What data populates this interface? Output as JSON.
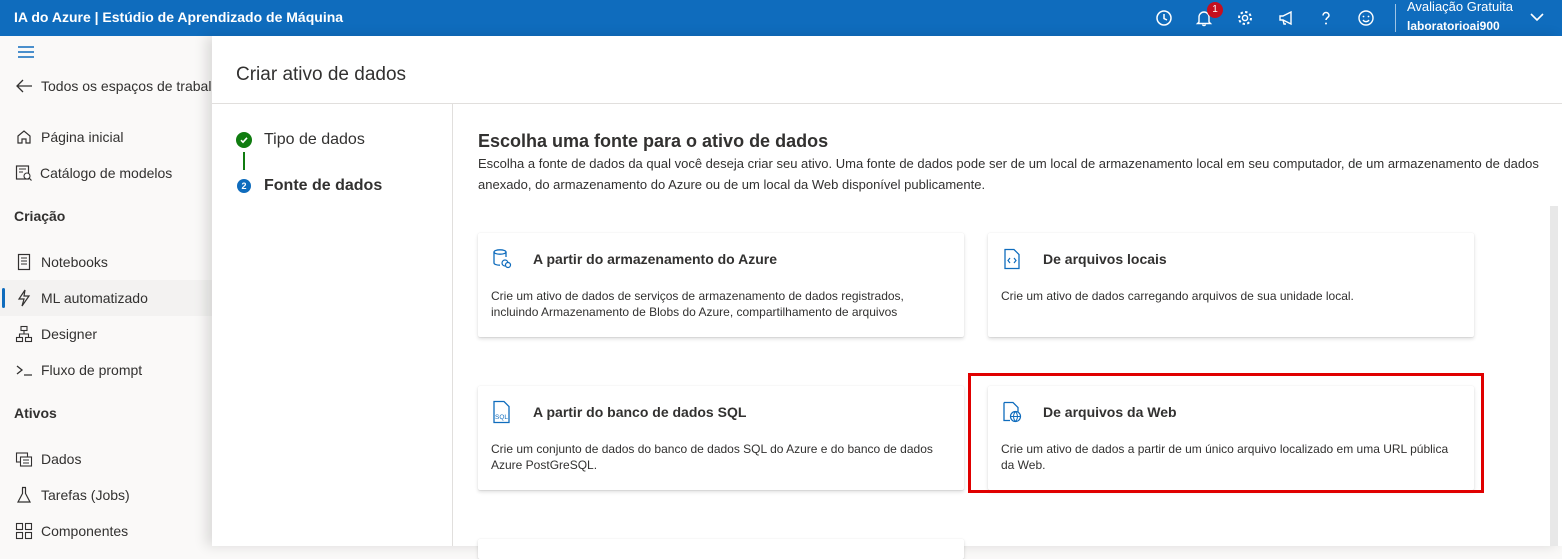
{
  "app": {
    "title": "IA do Azure | Estúdio de Aprendizado de Máquina",
    "notification_count": "1",
    "account_plan": "Avaliação Gratuita",
    "account_name": "laboratorioai900"
  },
  "topbar_icons": [
    "clock-icon",
    "bell-icon",
    "gear-icon",
    "megaphone-icon",
    "help-icon",
    "smiley-icon",
    "chevron-down-icon"
  ],
  "nav": {
    "back_label": "Todos os espaços de trabal",
    "home_label": "Página inicial",
    "catalog_label": "Catálogo de modelos",
    "section_creation": "Criação",
    "notebooks_label": "Notebooks",
    "automl_label": "ML automatizado",
    "designer_label": "Designer",
    "prompt_flow_label": "Fluxo de prompt",
    "section_assets": "Ativos",
    "data_label": "Dados",
    "jobs_label": "Tarefas (Jobs)",
    "components_label": "Componentes"
  },
  "panel": {
    "title": "Criar ativo de dados",
    "steps": [
      {
        "label": "Tipo de dados",
        "status": "done"
      },
      {
        "label": "Fonte de dados",
        "status": "current",
        "number": "2"
      }
    ],
    "section_title": "Escolha uma fonte para o ativo de dados",
    "section_desc": "Escolha a fonte de dados da qual você deseja criar seu ativo. Uma fonte de dados pode ser de um local de armazenamento local em seu computador, de um armazenamento de dados anexado, do armazenamento do Azure ou de um local da Web disponível publicamente.",
    "cards": [
      {
        "title": "A partir do armazenamento do Azure",
        "desc": "Crie um ativo de dados de serviços de armazenamento de dados registrados, incluindo Armazenamento de Blobs do Azure, compartilhamento de arquivos"
      },
      {
        "title": "De arquivos locais",
        "desc": "Crie um ativo de dados carregando arquivos de sua unidade local."
      },
      {
        "title": "A partir do banco de dados SQL",
        "desc": "Crie um conjunto de dados do banco de dados SQL do Azure e do banco de dados Azure PostGreSQL.",
        "icon_text": "SQL"
      },
      {
        "title": "De arquivos da Web",
        "desc": "Crie um ativo de dados a partir de um único arquivo localizado em uma URL pública da Web."
      }
    ]
  },
  "colors": {
    "accent": "#0f6cbd",
    "success": "#107c10",
    "highlight": "#e00000"
  }
}
